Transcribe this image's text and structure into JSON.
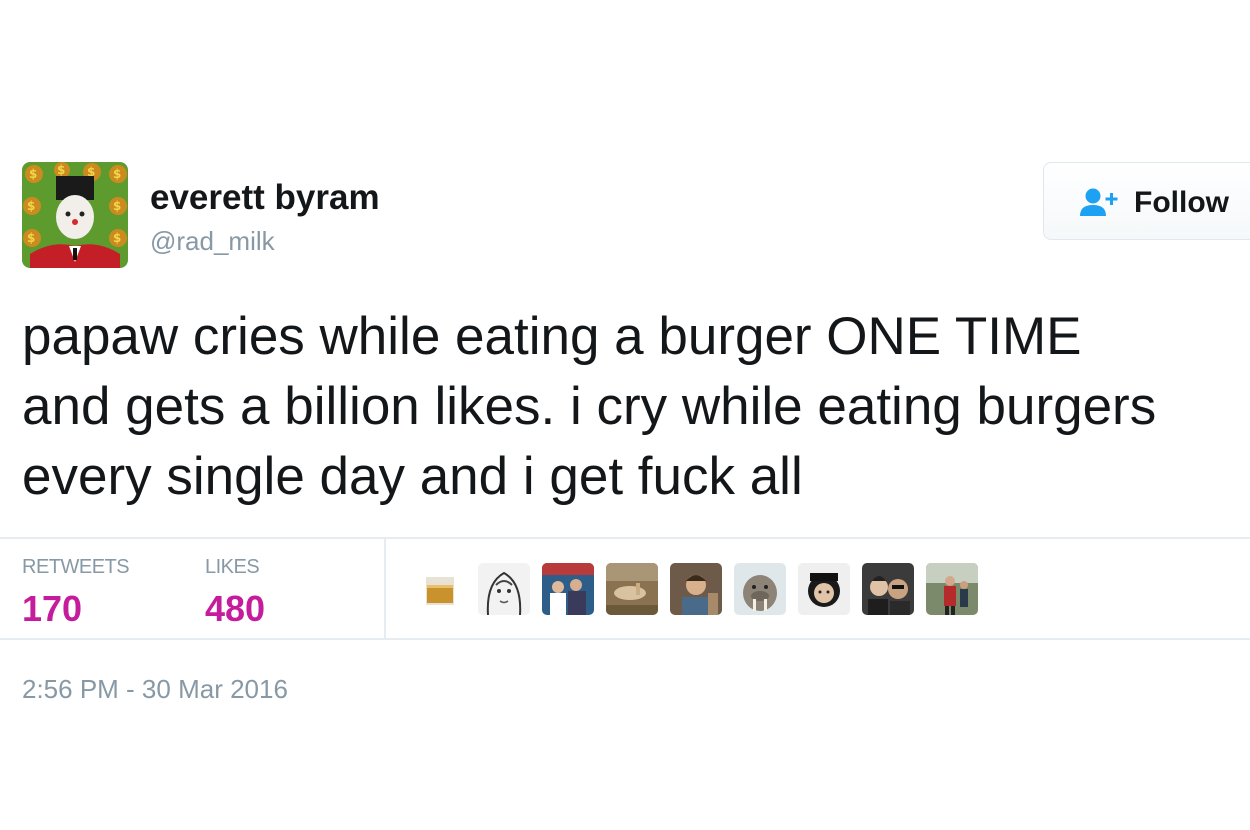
{
  "user": {
    "display_name": "everett byram",
    "handle": "@rad_milk",
    "avatar_icon": "profile-avatar"
  },
  "follow_button": {
    "label": "Follow",
    "icon": "add-user-icon",
    "icon_color": "#1da1f2"
  },
  "tweet": {
    "text": "papaw cries while eating a burger ONE TIME\nand gets a billion likes. i cry while eating burgers\nevery single day and i get fuck all",
    "timestamp": "2:56 PM - 30 Mar 2016"
  },
  "stats": {
    "retweets_label": "RETWEETS",
    "retweets_value": "170",
    "likes_label": "LIKES",
    "likes_value": "480",
    "value_color": "#c51c9e"
  },
  "likers": [
    "liker-avatar-whiskey-glass",
    "liker-avatar-drawing",
    "liker-avatar-group",
    "liker-avatar-outdoor",
    "liker-avatar-person",
    "liker-avatar-walrus",
    "liker-avatar-hat",
    "liker-avatar-selfie",
    "liker-avatar-standing"
  ]
}
